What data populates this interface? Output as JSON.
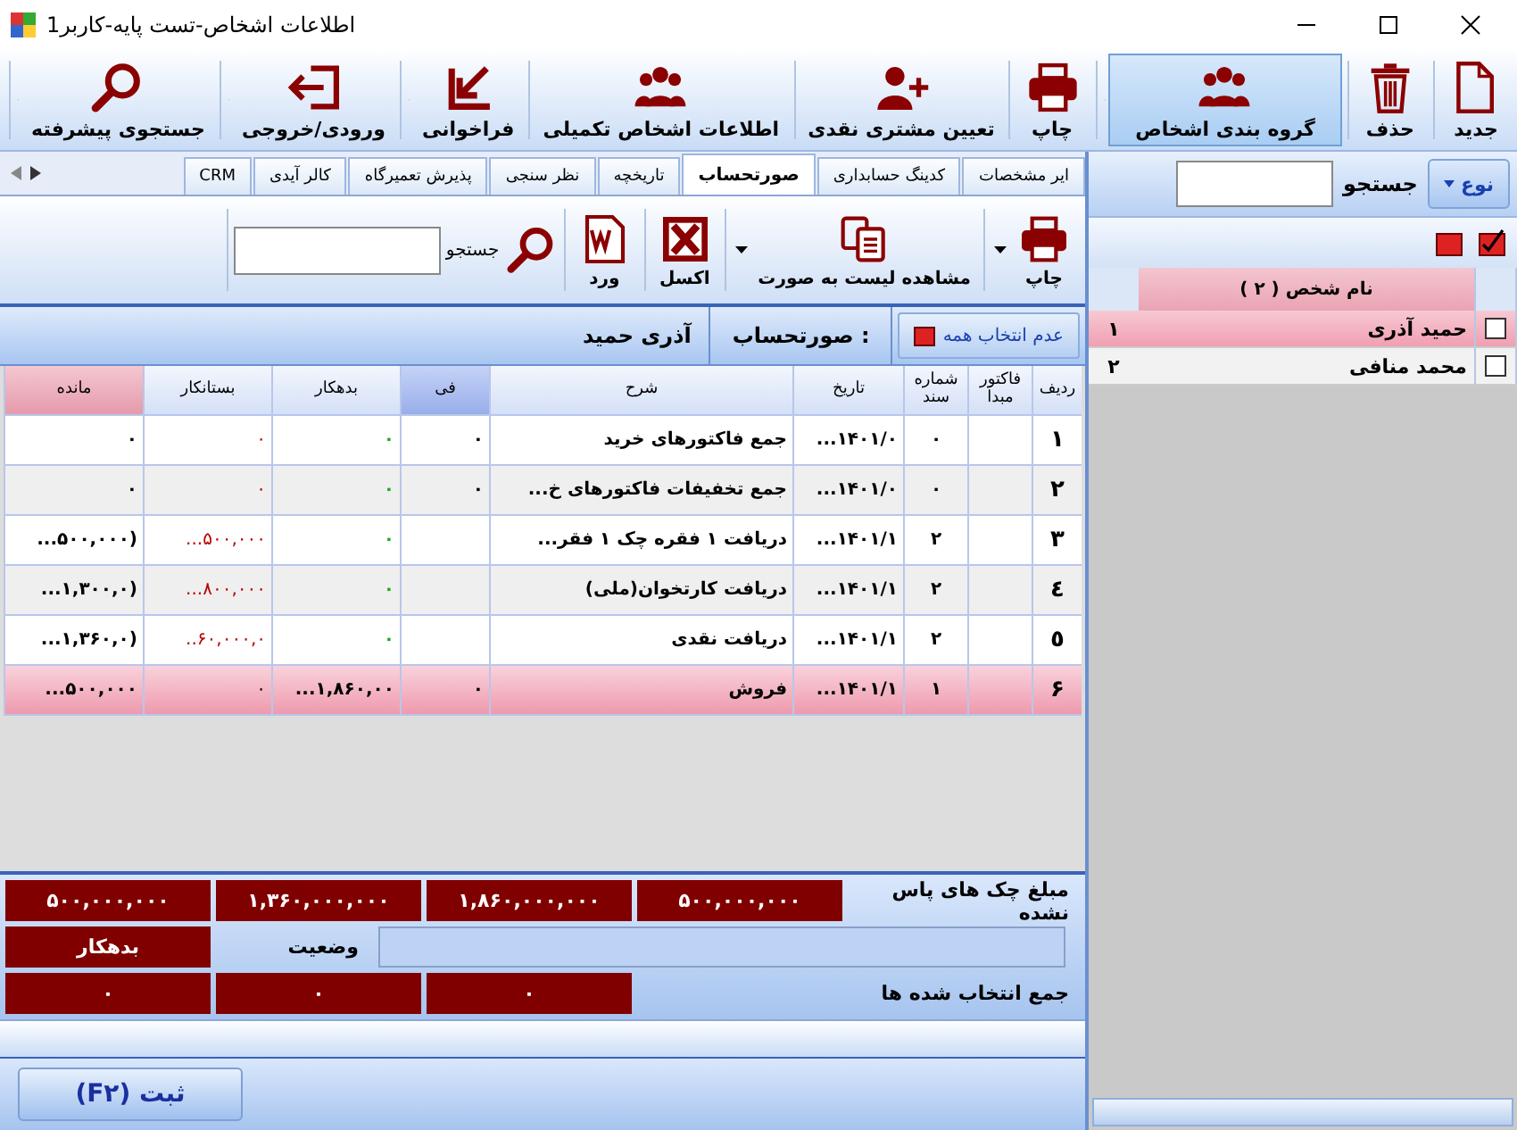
{
  "window": {
    "title": "اطلاعات اشخاص-تست پایه-کاربر1"
  },
  "toolbar": [
    {
      "label": "جدید",
      "selected": false,
      "dropdown": false
    },
    {
      "label": "حذف",
      "selected": false,
      "dropdown": false
    },
    {
      "label": "گروه بندی اشخاص",
      "selected": true,
      "dropdown": true
    },
    {
      "label": "چاپ",
      "selected": false,
      "dropdown": false
    },
    {
      "label": "تعیین مشتری نقدی",
      "selected": false,
      "dropdown": false
    },
    {
      "label": "اطلاعات اشخاص تکمیلی",
      "selected": false,
      "dropdown": false
    },
    {
      "label": "فراخوانی",
      "selected": false,
      "dropdown": true
    },
    {
      "label": "ورودی/خروجی",
      "selected": false,
      "dropdown": true
    },
    {
      "label": "جستجوی پیشرفته",
      "selected": false,
      "dropdown": true
    }
  ],
  "tabs": [
    {
      "label": "ایر مشخصات",
      "selected": false
    },
    {
      "label": "کدینگ حسابداری",
      "selected": false
    },
    {
      "label": "صورتحساب",
      "selected": true
    },
    {
      "label": "تاریخچه",
      "selected": false
    },
    {
      "label": "نظر سنجی",
      "selected": false
    },
    {
      "label": "پذیرش تعمیرگاه",
      "selected": false
    },
    {
      "label": "کالر آیدی",
      "selected": false
    },
    {
      "label": "CRM",
      "selected": false
    }
  ],
  "statement_toolbar": {
    "print": "چاپ",
    "view_list": "مشاهده لیست به صورت",
    "excel": "اکسل",
    "word": "ورد",
    "search_label": "جستجو"
  },
  "statement_header": {
    "deselect_all": "عدم انتخاب همه",
    "label": "صورتحساب :",
    "person": "آذری حمید"
  },
  "table": {
    "columns": [
      "ردیف",
      "فاکتور مبدا",
      "شماره سند",
      "تاریخ",
      "شرح",
      "فی",
      "بدهکار",
      "بستانکار",
      "مانده"
    ],
    "rows": [
      {
        "cells": [
          "۱",
          "",
          "۰",
          "۱۴۰۱/۰...",
          "جمع فاکتورهای خرید",
          "۰",
          "۰",
          "۰",
          "۰"
        ],
        "selected": false
      },
      {
        "cells": [
          "۲",
          "",
          "۰",
          "۱۴۰۱/۰...",
          "جمع تخفیفات فاکتورهای خ...",
          "۰",
          "۰",
          "۰",
          "۰"
        ],
        "selected": false
      },
      {
        "cells": [
          "۳",
          "",
          "۲",
          "۱۴۰۱/۱...",
          "دریافت ۱ فقره چک  ۱ فقر...",
          "",
          "۰",
          "۵۰۰,۰۰۰...",
          "(۵۰۰,۰۰۰..."
        ],
        "selected": false
      },
      {
        "cells": [
          "٤",
          "",
          "۲",
          "۱۴۰۱/۱...",
          "دریافت کارتخوان(ملی)",
          "",
          "۰",
          "۸۰۰,۰۰۰...",
          "(۱,۳۰۰,۰..."
        ],
        "selected": false
      },
      {
        "cells": [
          "٥",
          "",
          "۲",
          "۱۴۰۱/۱...",
          "دریافت نقدی",
          "",
          "۰",
          "۶۰,۰۰۰,۰..",
          "(۱,۳۶۰,۰..."
        ],
        "selected": false
      },
      {
        "cells": [
          "۶",
          "",
          "۱",
          "۱۴۰۱/۱...",
          "فروش",
          "۰",
          "۱,۸۶۰,۰۰...",
          "۰",
          "۵۰۰,۰۰۰..."
        ],
        "selected": true
      }
    ]
  },
  "summary": {
    "uncleared_cheques_label": "مبلغ چک های پاس نشده",
    "uncleared_values": [
      "۵۰۰,۰۰۰,۰۰۰",
      "۱,۸۶۰,۰۰۰,۰۰۰",
      "۱,۳۶۰,۰۰۰,۰۰۰",
      "۵۰۰,۰۰۰,۰۰۰"
    ],
    "status_label": "وضعیت",
    "status_value": "بدهکار",
    "selected_total_label": "جمع انتخاب شده ها",
    "selected_values": [
      "۰",
      "۰",
      "۰"
    ]
  },
  "save_button": "ثبت  (F۲)",
  "people_panel": {
    "type_button": "نوع",
    "search_label": "جستجو",
    "column": "نام شخص ( ۲ )",
    "rows": [
      {
        "name": "حمید آذری",
        "index": "۱",
        "checked": false,
        "selected": true
      },
      {
        "name": "محمد منافی",
        "index": "۲",
        "checked": false,
        "selected": false
      }
    ]
  }
}
